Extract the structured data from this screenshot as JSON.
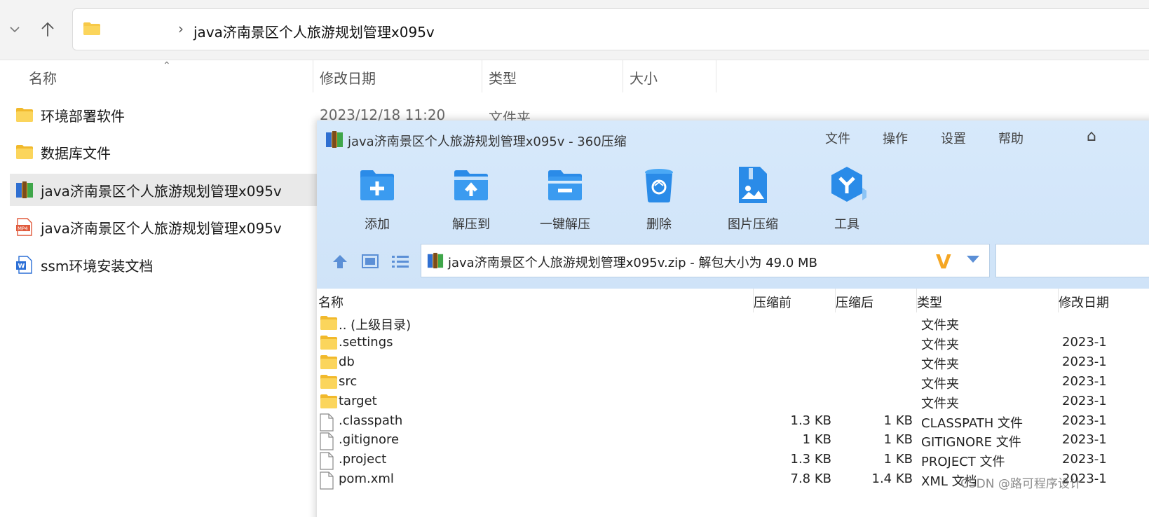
{
  "explorer": {
    "address_path": "java济南景区个人旅游规划管理x095v",
    "columns": {
      "name": "名称",
      "modified": "修改日期",
      "type": "类型",
      "size": "大小"
    },
    "items": [
      {
        "name": "环境部署软件",
        "icon": "folder-icon"
      },
      {
        "name": "数据库文件",
        "icon": "folder-icon"
      },
      {
        "name": "java济南景区个人旅游规划管理x095v",
        "icon": "zip-archive-icon"
      },
      {
        "name": "java济南景区个人旅游规划管理x095v",
        "icon": "mp4-file-icon"
      },
      {
        "name": "ssm环境安装文档",
        "icon": "word-doc-icon"
      }
    ],
    "first_row_date": "2023/12/18 11:20",
    "first_row_type": "文件夹"
  },
  "zip": {
    "title": "java济南景区个人旅游规划管理x095v - 360压缩",
    "menu": [
      "文件",
      "操作",
      "设置",
      "帮助"
    ],
    "toolbar": [
      {
        "label": "添加",
        "icon": "add-folder-icon"
      },
      {
        "label": "解压到",
        "icon": "extract-to-icon"
      },
      {
        "label": "一键解压",
        "icon": "one-click-extract-icon"
      },
      {
        "label": "删除",
        "icon": "delete-bin-icon"
      },
      {
        "label": "图片压缩",
        "icon": "image-compress-icon"
      },
      {
        "label": "工具",
        "icon": "tools-icon"
      }
    ],
    "path_text": "java济南景区个人旅游规划管理x095v.zip - 解包大小为 49.0 MB",
    "columns": {
      "name": "名称",
      "before": "压缩前",
      "after": "压缩后",
      "type": "类型",
      "modified": "修改日期"
    },
    "rows": [
      {
        "name": ".. (上级目录)",
        "before": "",
        "after": "",
        "type": "文件夹",
        "date": "",
        "kind": "folder"
      },
      {
        "name": ".settings",
        "before": "",
        "after": "",
        "type": "文件夹",
        "date": "2023-1",
        "kind": "folder"
      },
      {
        "name": "db",
        "before": "",
        "after": "",
        "type": "文件夹",
        "date": "2023-1",
        "kind": "folder"
      },
      {
        "name": "src",
        "before": "",
        "after": "",
        "type": "文件夹",
        "date": "2023-1",
        "kind": "folder"
      },
      {
        "name": "target",
        "before": "",
        "after": "",
        "type": "文件夹",
        "date": "2023-1",
        "kind": "folder"
      },
      {
        "name": ".classpath",
        "before": "1.3 KB",
        "after": "1 KB",
        "type": "CLASSPATH 文件",
        "date": "2023-1",
        "kind": "file"
      },
      {
        "name": ".gitignore",
        "before": "1 KB",
        "after": "1 KB",
        "type": "GITIGNORE 文件",
        "date": "2023-1",
        "kind": "file"
      },
      {
        "name": ".project",
        "before": "1.3 KB",
        "after": "1 KB",
        "type": "PROJECT 文件",
        "date": "2023-1",
        "kind": "file"
      },
      {
        "name": "pom.xml",
        "before": "7.8 KB",
        "after": "1.4 KB",
        "type": "XML 文档",
        "date": "2023-1",
        "kind": "file"
      }
    ]
  },
  "watermark": "CSDN @路可程序设计",
  "colors": {
    "zip_header": "#d7e9fb",
    "folder": "#f7c948",
    "toolbar_blue": "#2a8be8",
    "v_logo": "#f5a623"
  }
}
